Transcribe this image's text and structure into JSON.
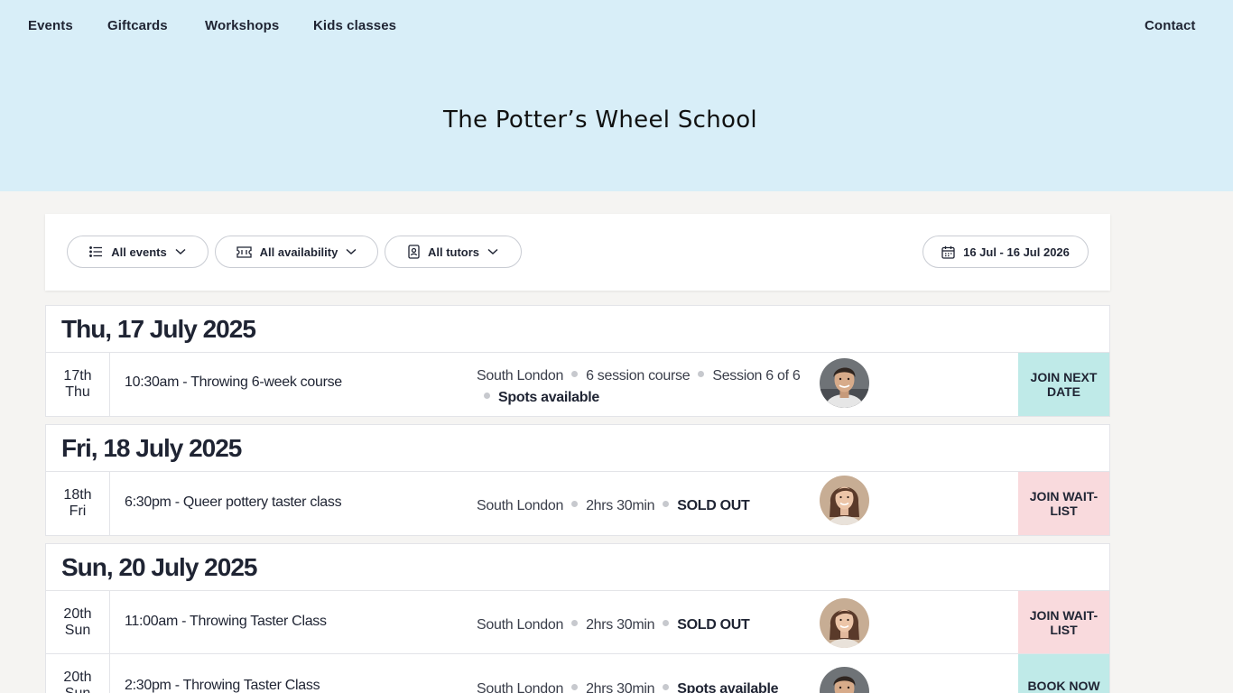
{
  "nav": {
    "items": [
      "Events",
      "Giftcards",
      "Workshops",
      "Kids classes"
    ],
    "contact": "Contact"
  },
  "site": {
    "title": "The Potter’s Wheel School"
  },
  "filters": {
    "events": "All events",
    "availability": "All availability",
    "tutors": "All tutors",
    "date_range": "16 Jul - 16 Jul 2026"
  },
  "days": [
    {
      "heading": "Thu, 17 July 2025",
      "events": [
        {
          "date_num": "17th",
          "date_day": "Thu",
          "title": "10:30am - Throwing 6-week course",
          "location": "South London",
          "detail1": "6 session course",
          "detail2": "Session 6 of 6",
          "status": "Spots available",
          "avatar": "male-tutor",
          "action": "JOIN NEXT DATE",
          "action_color": "#bfeae8"
        }
      ]
    },
    {
      "heading": "Fri, 18 July 2025",
      "events": [
        {
          "date_num": "18th",
          "date_day": "Fri",
          "title": "6:30pm - Queer pottery taster class",
          "location": "South London",
          "detail1": "2hrs 30min",
          "status": "SOLD OUT",
          "avatar": "female-tutor",
          "action": "JOIN WAIT-LIST",
          "action_color": "#f9dadd"
        }
      ]
    },
    {
      "heading": "Sun, 20 July 2025",
      "events": [
        {
          "date_num": "20th",
          "date_day": "Sun",
          "title": "11:00am - Throwing Taster Class",
          "location": "South London",
          "detail1": "2hrs 30min",
          "status": "SOLD OUT",
          "avatar": "female-tutor",
          "action": "JOIN WAIT-LIST",
          "action_color": "#f9dadd"
        },
        {
          "date_num": "20th",
          "date_day": "Sun",
          "title": "2:30pm - Throwing Taster Class",
          "location": "South London",
          "detail1": "2hrs 30min",
          "status": "Spots available",
          "avatar": "male-tutor",
          "action": "BOOK NOW",
          "action_color": "#bfeae8"
        }
      ]
    }
  ],
  "colors": {
    "header_bg": "#d8eef8",
    "page_bg": "#f5f4f2",
    "teal_action": "#bfeae8",
    "pink_action": "#f9dadd",
    "text": "#1f2433"
  }
}
